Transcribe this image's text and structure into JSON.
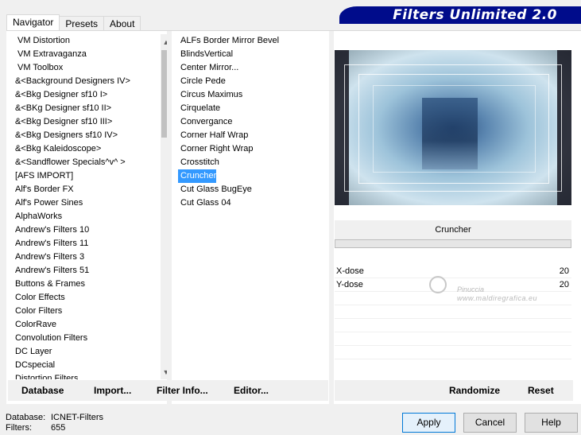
{
  "tabs": [
    "Navigator",
    "Presets",
    "About"
  ],
  "banner_title": "Filters Unlimited 2.0",
  "categories": [
    "VM Distortion",
    "VM Extravaganza",
    "VM Toolbox",
    "&<Background Designers IV>",
    "&<Bkg Designer sf10 I>",
    "&<BKg Designer sf10 II>",
    "&<Bkg Designer sf10 III>",
    "&<Bkg Designers sf10 IV>",
    "&<Bkg Kaleidoscope>",
    "&<Sandflower Specials^v^ >",
    "[AFS IMPORT]",
    "Alf's Border FX",
    "Alf's Power Sines",
    "AlphaWorks",
    "Andrew's Filters 10",
    "Andrew's Filters 11",
    "Andrew's Filters 3",
    "Andrew's Filters 51",
    "Buttons & Frames",
    "Color Effects",
    "Color Filters",
    "ColorRave",
    "Convolution Filters",
    "DC Layer",
    "DCspecial",
    "Distortion Filters"
  ],
  "filters": [
    "ALFs Border Mirror Bevel",
    "BlindsVertical",
    "Center Mirror...",
    "Circle Pede",
    "Circus Maximus",
    "Cirquelate",
    "Convergance",
    "Corner Half Wrap",
    "Corner Right Wrap",
    "Crosstitch",
    "Cruncher",
    "Cut Glass  BugEye",
    "Cut Glass 04"
  ],
  "selected_filter": "Cruncher",
  "selected_filter_index": 10,
  "filter_name_display": "Cruncher",
  "params": [
    {
      "name": "X-dose",
      "value": "20"
    },
    {
      "name": "Y-dose",
      "value": "20"
    }
  ],
  "watermark": {
    "line1": "Pinuccia",
    "line2": "www.maldiregrafica.eu"
  },
  "bottom_buttons": {
    "database": "Database",
    "import": "Import...",
    "filter_info": "Filter Info...",
    "editor": "Editor...",
    "randomize": "Randomize",
    "reset": "Reset"
  },
  "status": {
    "database_label": "Database:",
    "database_value": "ICNET-Filters",
    "filters_label": "Filters:",
    "filters_value": "655"
  },
  "dialog_buttons": {
    "apply": "Apply",
    "cancel": "Cancel",
    "help": "Help"
  },
  "colors": {
    "selection": "#3399ff",
    "banner": "#000c8b",
    "default_button_border": "#0078d7"
  }
}
